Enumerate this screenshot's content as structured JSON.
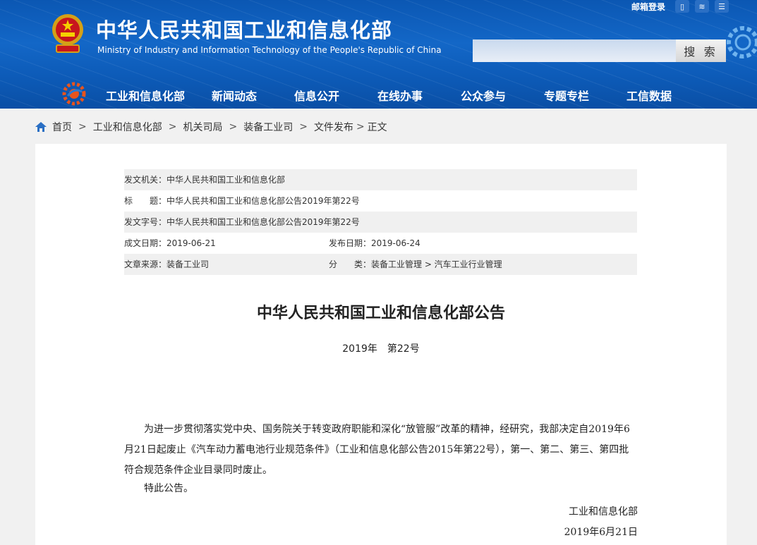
{
  "header": {
    "title": "中华人民共和国工业和信息化部",
    "subtitle": "Ministry of Industry and Information Technology of the People's Republic of China",
    "mail_login": "邮箱登录",
    "search_button": "搜 索",
    "search_value": ""
  },
  "nav": {
    "items": [
      "工业和信息化部",
      "新闻动态",
      "信息公开",
      "在线办事",
      "公众参与",
      "专题专栏",
      "工信数据"
    ]
  },
  "breadcrumb": [
    "首页",
    "工业和信息化部",
    "机关司局",
    "装备工业司",
    "文件发布",
    "正文"
  ],
  "meta": {
    "issuer": "发文机关：中华人民共和国工业和信息化部",
    "title": "标　　题：中华人民共和国工业和信息化部公告2019年第22号",
    "doc_number": "发文字号：中华人民共和国工业和信息化部公告2019年第22号",
    "created_date": "成文日期：2019-06-21",
    "published_date": "发布日期：2019-06-24",
    "source": "文章来源：装备工业司",
    "category": "分　　类：装备工业管理 > 汽车工业行业管理"
  },
  "document": {
    "title": "中华人民共和国工业和信息化部公告",
    "number": "2019年　第22号",
    "body": "为进一步贯彻落实党中央、国务院关于转变政府职能和深化“放管服”改革的精神，经研究，我部决定自2019年6月21日起废止《汽车动力蓄电池行业规范条件》（工业和信息化部公告2015年第22号），第一、第二、第三、第四批符合规范条件企业目录同时废止。",
    "closing": "特此公告。",
    "signer": "工业和信息化部",
    "date": "2019年6月21日"
  },
  "colors": {
    "header_blue": "#0d5bb8",
    "page_bg": "#f1f1f1",
    "meta_shade": "#f0f0f0"
  }
}
